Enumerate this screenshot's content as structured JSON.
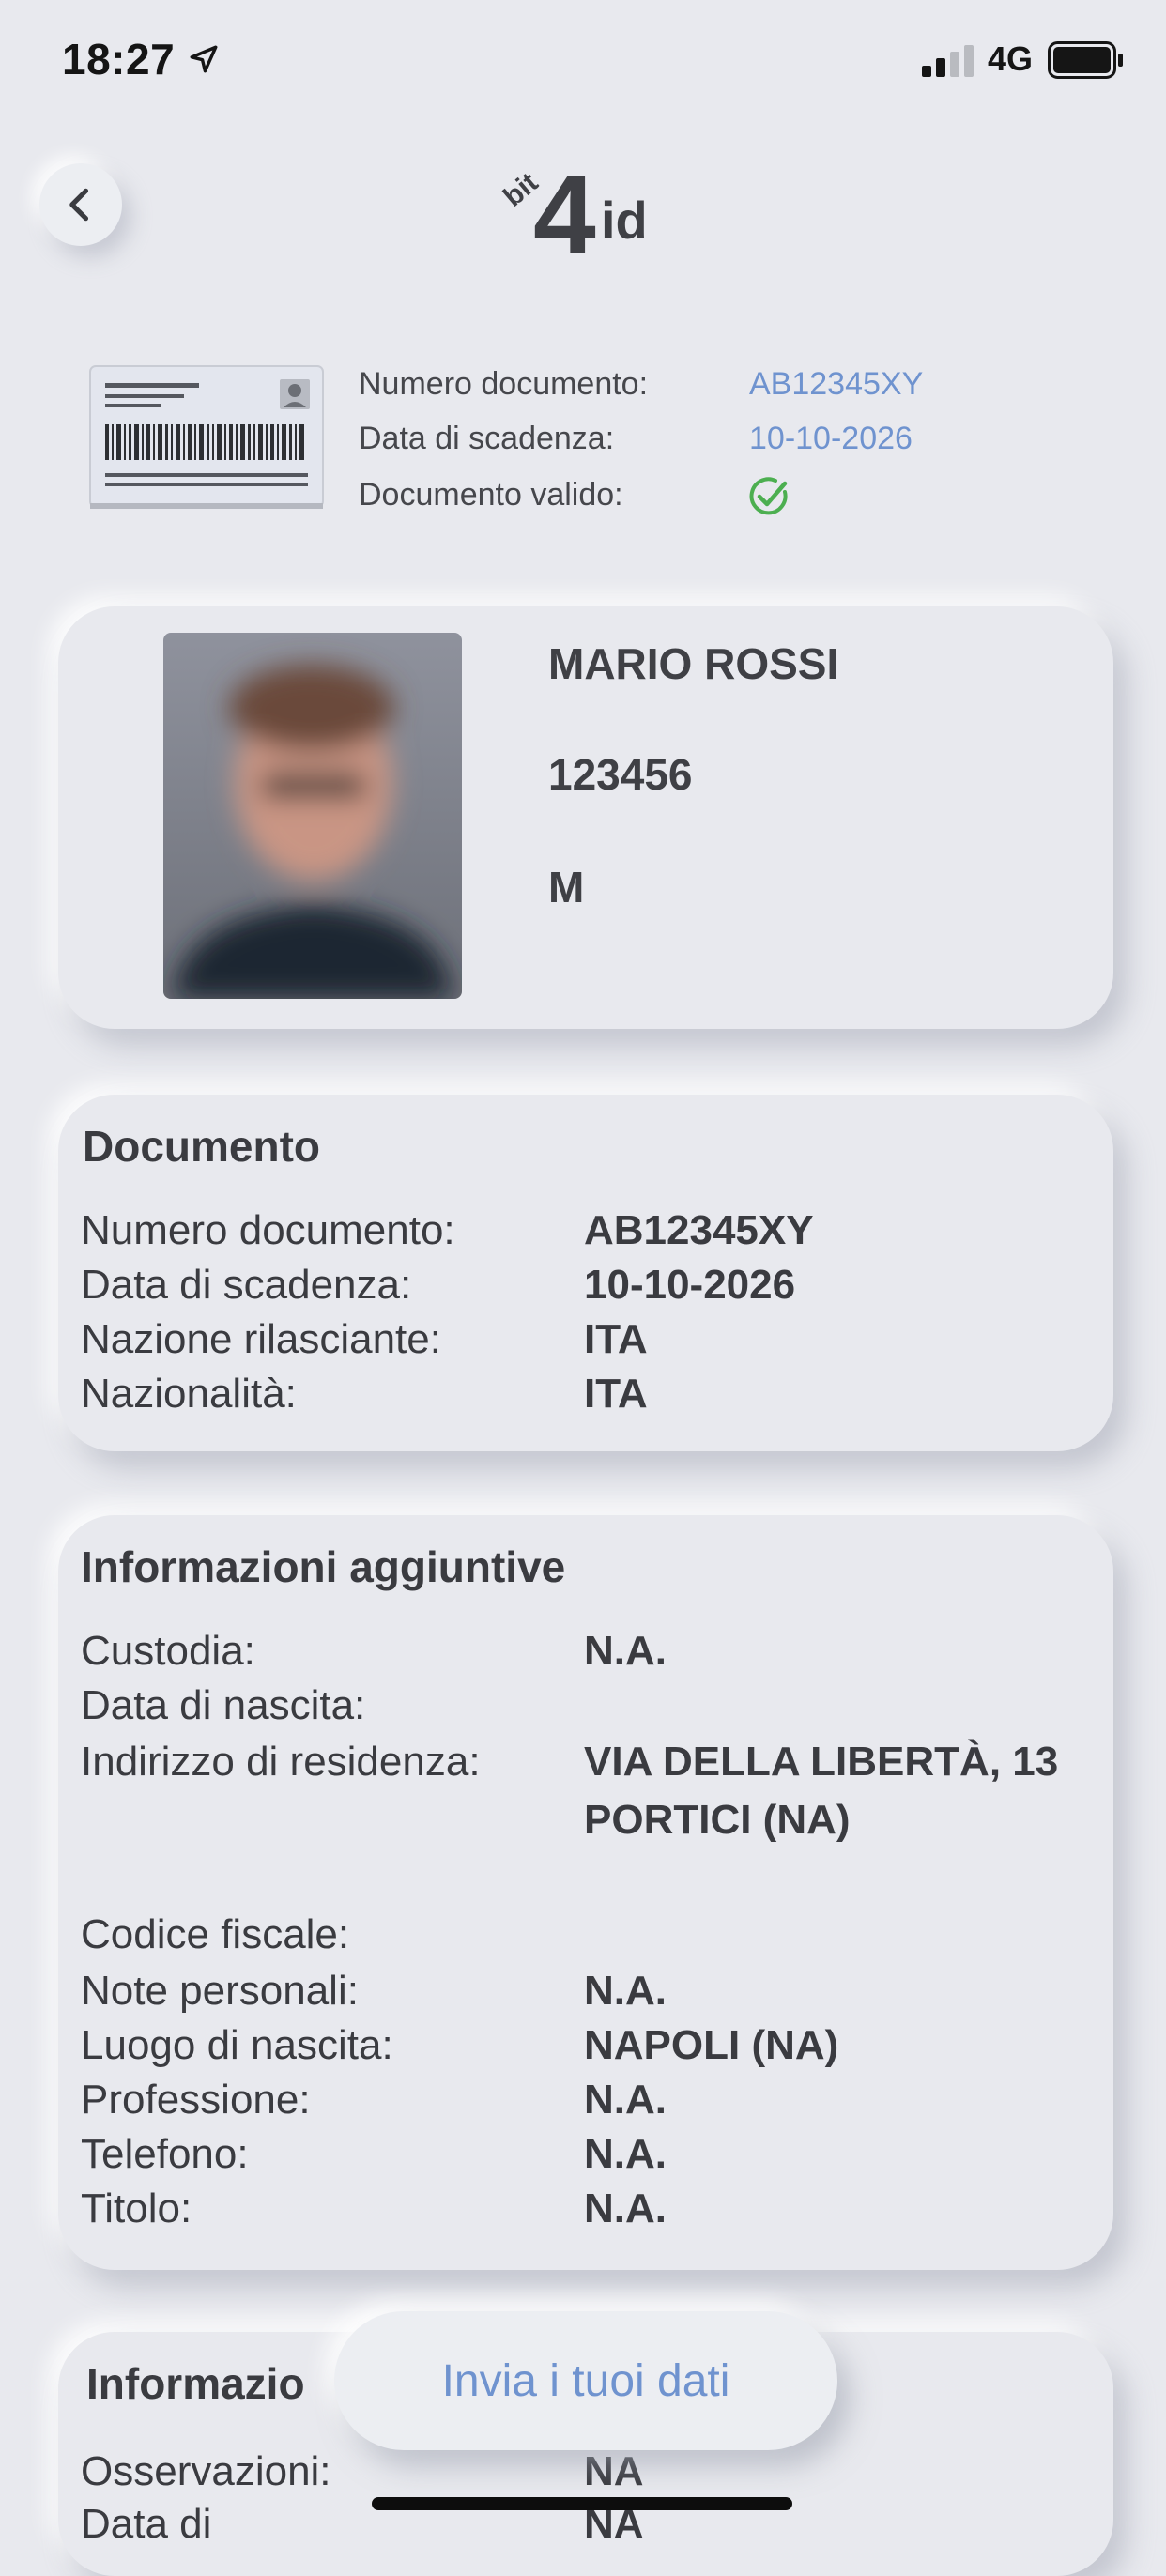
{
  "status_bar": {
    "time": "18:27",
    "network": "4G"
  },
  "header": {
    "logo_text_small": "bit",
    "logo_text_big": "4",
    "logo_text_id": "id"
  },
  "summary": {
    "items": [
      {
        "label": "Numero documento:",
        "value": "AB12345XY"
      },
      {
        "label": "Data di scadenza:",
        "value": "10-10-2026"
      },
      {
        "label": "Documento valido:",
        "value": ""
      }
    ]
  },
  "profile": {
    "name": "MARIO ROSSI",
    "number": "123456",
    "sex": "M"
  },
  "documento": {
    "title": "Documento",
    "rows": [
      {
        "label": "Numero documento:",
        "value": "AB12345XY"
      },
      {
        "label": "Data di scadenza:",
        "value": "10-10-2026"
      },
      {
        "label": "Nazione rilasciante:",
        "value": "ITA"
      },
      {
        "label": "Nazionalità:",
        "value": "ITA"
      }
    ]
  },
  "info": {
    "title": "Informazioni aggiuntive",
    "rows": [
      {
        "label": "Custodia:",
        "value": "N.A."
      },
      {
        "label": "Data di nascita:",
        "value": ""
      },
      {
        "label": "Indirizzo di residenza:",
        "value": "VIA DELLA LIBERTÀ, 13",
        "value2": "PORTICI (NA)"
      },
      {
        "label": "Codice fiscale:",
        "value": ""
      },
      {
        "label": "Note personali:",
        "value": "N.A."
      },
      {
        "label": "Luogo di nascita:",
        "value": "NAPOLI (NA)"
      },
      {
        "label": "Professione:",
        "value": "N.A."
      },
      {
        "label": "Telefono:",
        "value": "N.A."
      },
      {
        "label": "Titolo:",
        "value": "N.A."
      }
    ]
  },
  "bottom_card": {
    "title": "Informazio",
    "rows": [
      {
        "label": "Osservazioni:",
        "value": "NA"
      },
      {
        "label": "Data di",
        "value": "NA"
      }
    ]
  },
  "fab": {
    "label": "Invia i tuoi dati"
  },
  "colors": {
    "accent": "#6f93cf",
    "valid_green": "#4caf50",
    "background": "#e8e9ee"
  }
}
